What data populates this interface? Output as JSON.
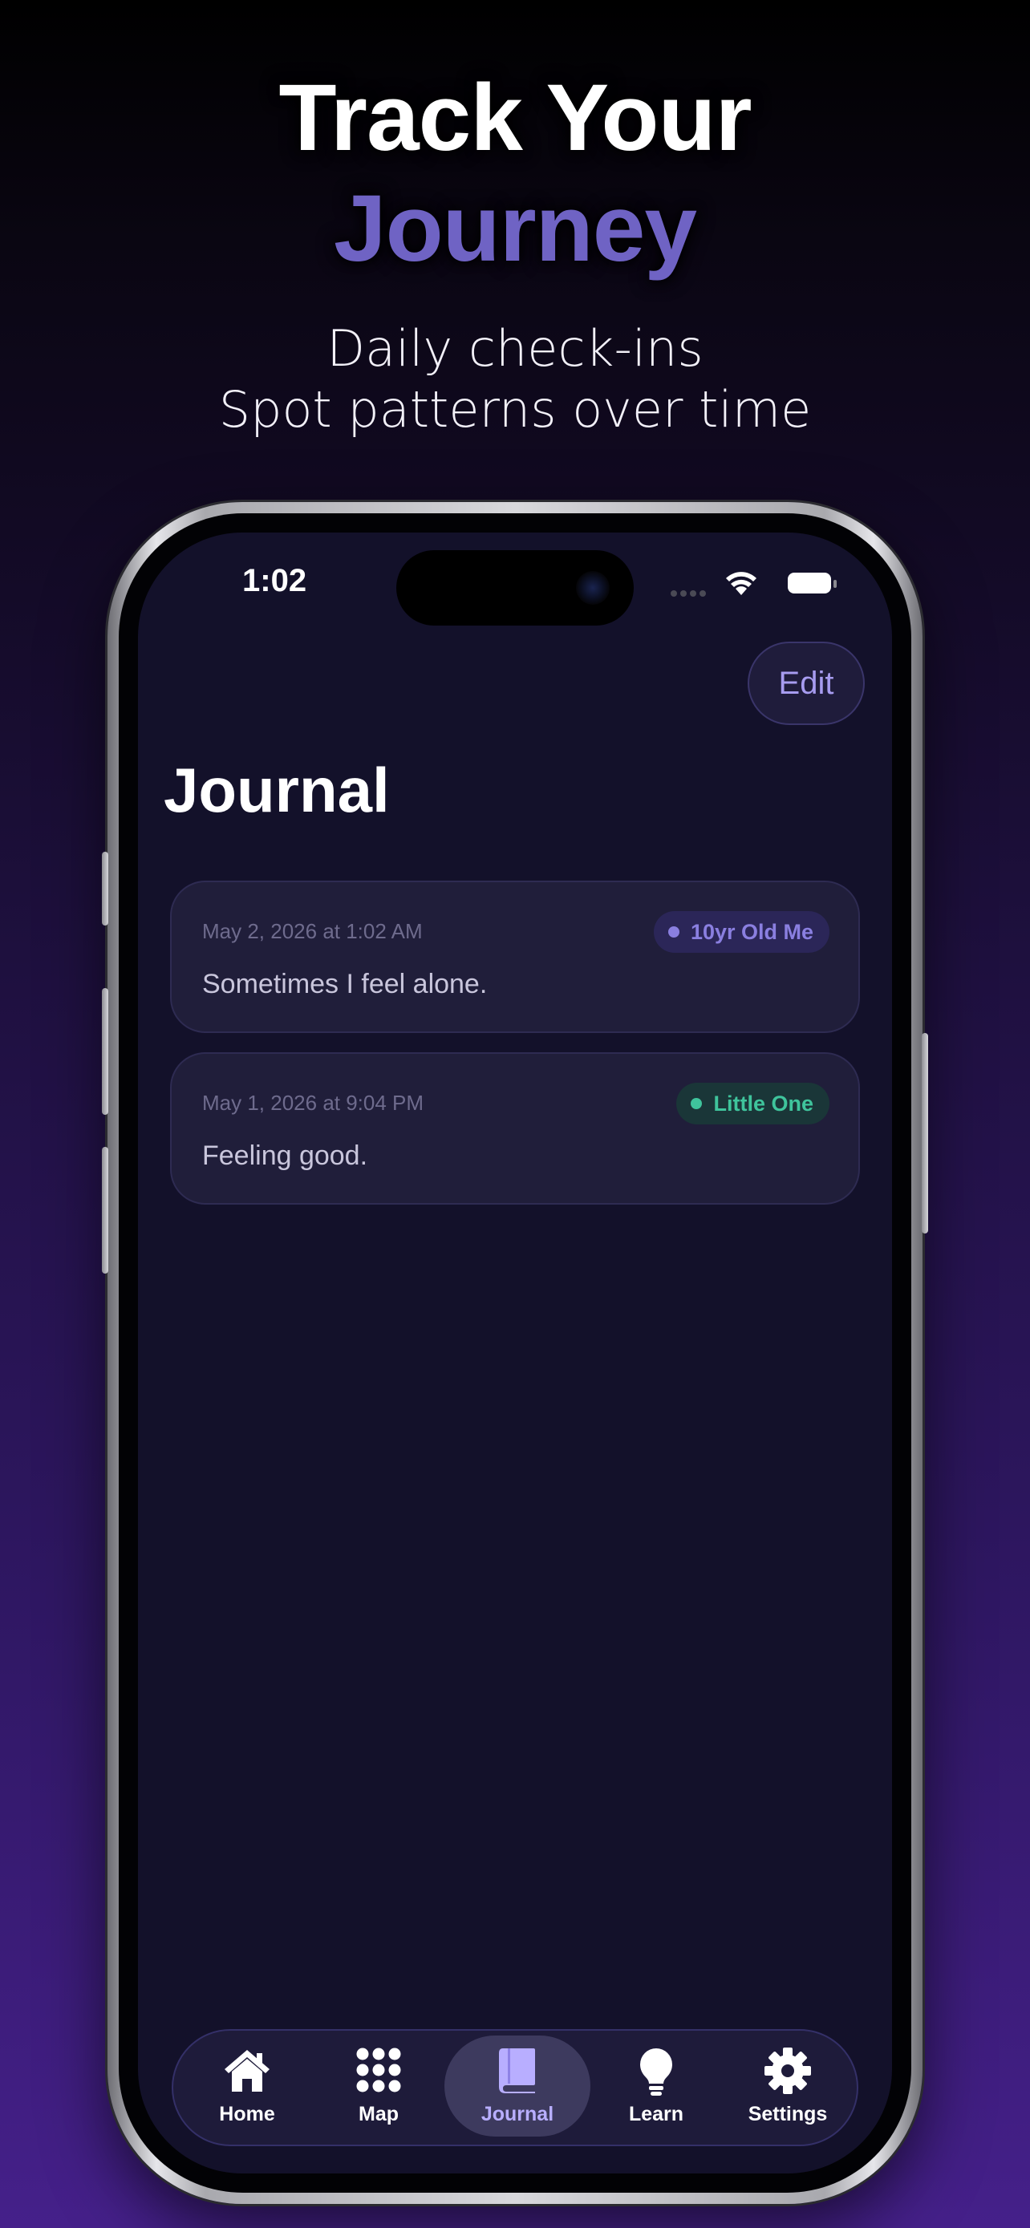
{
  "headline": {
    "line1": "Track Your",
    "line2": "Journey",
    "accent_color": "#6f63c4"
  },
  "subtitle": {
    "line1": "Daily check-ins",
    "line2": "Spot patterns over time"
  },
  "status_bar": {
    "time": "1:02"
  },
  "header": {
    "edit_label": "Edit",
    "title": "Journal"
  },
  "entries": [
    {
      "date": "May 2, 2026 at 1:02 AM",
      "text": "Sometimes I feel alone.",
      "tag": "10yr Old Me",
      "tag_color": "#8a7fe0"
    },
    {
      "date": "May 1, 2026 at 9:04 PM",
      "text": "Feeling good.",
      "tag": "Little One",
      "tag_color": "#3fc49c"
    }
  ],
  "tabbar": {
    "items": [
      {
        "label": "Home",
        "icon": "home-icon"
      },
      {
        "label": "Map",
        "icon": "grid-dots-icon"
      },
      {
        "label": "Journal",
        "icon": "book-icon",
        "selected": true
      },
      {
        "label": "Learn",
        "icon": "lightbulb-icon"
      },
      {
        "label": "Settings",
        "icon": "gear-icon"
      }
    ]
  }
}
